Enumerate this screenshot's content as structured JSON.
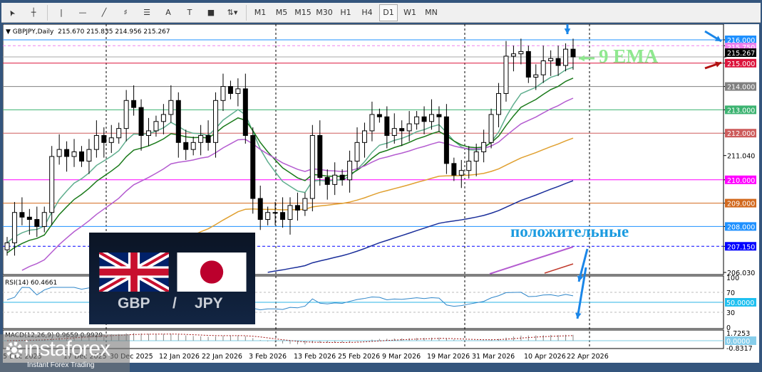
{
  "toolbar": {
    "tools": [
      "cursor-icon",
      "crosshair-icon",
      "vertical-line-icon",
      "horizontal-line-icon",
      "trendline-icon",
      "fibonacci-icon",
      "fibo-levels-icon",
      "text-icon",
      "text-label-icon",
      "rectangle-icon",
      "arrows-icon"
    ],
    "text_tool": "A",
    "timeframes": [
      "M1",
      "M5",
      "M15",
      "M30",
      "H1",
      "H4",
      "D1",
      "W1",
      "MN"
    ],
    "active": "D1"
  },
  "header": {
    "symbol": "GBPJPY,Daily",
    "open": "215.670",
    "high": "215.835",
    "low": "214.956",
    "close": "215.267"
  },
  "price_axis": {
    "labels": [
      {
        "price": 216.0,
        "text": "216.000",
        "bg": "#1e90ff"
      },
      {
        "price": 215.75,
        "text": "215.750",
        "bg": "#ee82ee"
      },
      {
        "price": 215.267,
        "text": "215.267",
        "bg": "#000000"
      },
      {
        "price": 215.0,
        "text": "215.000",
        "bg": "#dc143c"
      },
      {
        "price": 214.0,
        "text": "214.000",
        "bg": "#808080"
      },
      {
        "price": 213.0,
        "text": "213.000",
        "bg": "#3cb371"
      },
      {
        "price": 212.0,
        "text": "212.000",
        "bg": "#cd5c5c"
      },
      {
        "price": 211.04,
        "text": "211.040",
        "bg": ""
      },
      {
        "price": 210.0,
        "text": "210.000",
        "bg": "#ff00ff"
      },
      {
        "price": 209.0,
        "text": "209.000",
        "bg": "#d2691e"
      },
      {
        "price": 208.0,
        "text": "208.000",
        "bg": "#1e90ff"
      },
      {
        "price": 207.15,
        "text": "207.150",
        "bg": "#0000ff"
      },
      {
        "price": 206.03,
        "text": "206.030",
        "bg": ""
      }
    ]
  },
  "rsi": {
    "title": "RSI(14) 60.4661",
    "levels": [
      "100",
      "70",
      "50.0000",
      "30",
      "0"
    ]
  },
  "macd": {
    "title": "MACD(12,26,9) 0.9659 0.9929",
    "levels": [
      "1.7253",
      "0.0000",
      "-0.8317"
    ]
  },
  "dates": [
    "5 Dec 2025",
    "17 Dec 2025",
    "30 Dec 2025",
    "12 Jan 2026",
    "22 Jan 2026",
    "3 Feb 2026",
    "13 Feb 2026",
    "25 Feb 2026",
    "9 Mar 2026",
    "19 Mar 2026",
    "31 Mar 2026",
    "10 Apr 2026",
    "22 Apr 2026"
  ],
  "overlay": {
    "pair_base": "GBP",
    "pair_slash": "/",
    "pair_quote": "JPY",
    "annotation_ema": "9 EMA",
    "annotation_positive": "положительные"
  },
  "logo": {
    "brand": "instaforex",
    "tagline": "Instant Forex Trading"
  },
  "chart_data": {
    "type": "candlestick",
    "symbol": "GBPJPY",
    "timeframe": "Daily",
    "closes": [
      207.3,
      208.6,
      208.4,
      208.3,
      208.0,
      208.6,
      211.0,
      211.3,
      211.0,
      211.2,
      210.8,
      211.3,
      211.9,
      211.6,
      211.8,
      212.2,
      213.4,
      213.1,
      211.9,
      212.1,
      212.5,
      212.8,
      213.4,
      211.6,
      211.3,
      211.6,
      211.9,
      211.6,
      213.4,
      214.0,
      213.7,
      213.9,
      211.9,
      209.2,
      208.3,
      208.6,
      208.6,
      208.3,
      208.9,
      208.7,
      209.2,
      211.9,
      210.1,
      209.8,
      210.2,
      210.0,
      210.8,
      211.6,
      212.1,
      212.8,
      212.7,
      211.9,
      212.2,
      212.1,
      212.4,
      212.7,
      212.5,
      212.8,
      212.7,
      210.7,
      210.2,
      210.4,
      210.8,
      211.2,
      211.6,
      212.8,
      213.7,
      215.3,
      215.4,
      215.5,
      214.4,
      214.5,
      215.1,
      215.2,
      214.9,
      215.6,
      215.267
    ],
    "ylim": [
      206.03,
      216.9
    ],
    "rsi_last": 60.4661,
    "macd_main": 0.9659,
    "macd_signal": 0.9929
  },
  "colors": {
    "ema9": "#5fae8e",
    "ema_dark": "#1a7a1a",
    "ema_violet": "#b45cd0",
    "ma_orange": "#e0a030",
    "ma_navy": "#1a2e9a"
  }
}
